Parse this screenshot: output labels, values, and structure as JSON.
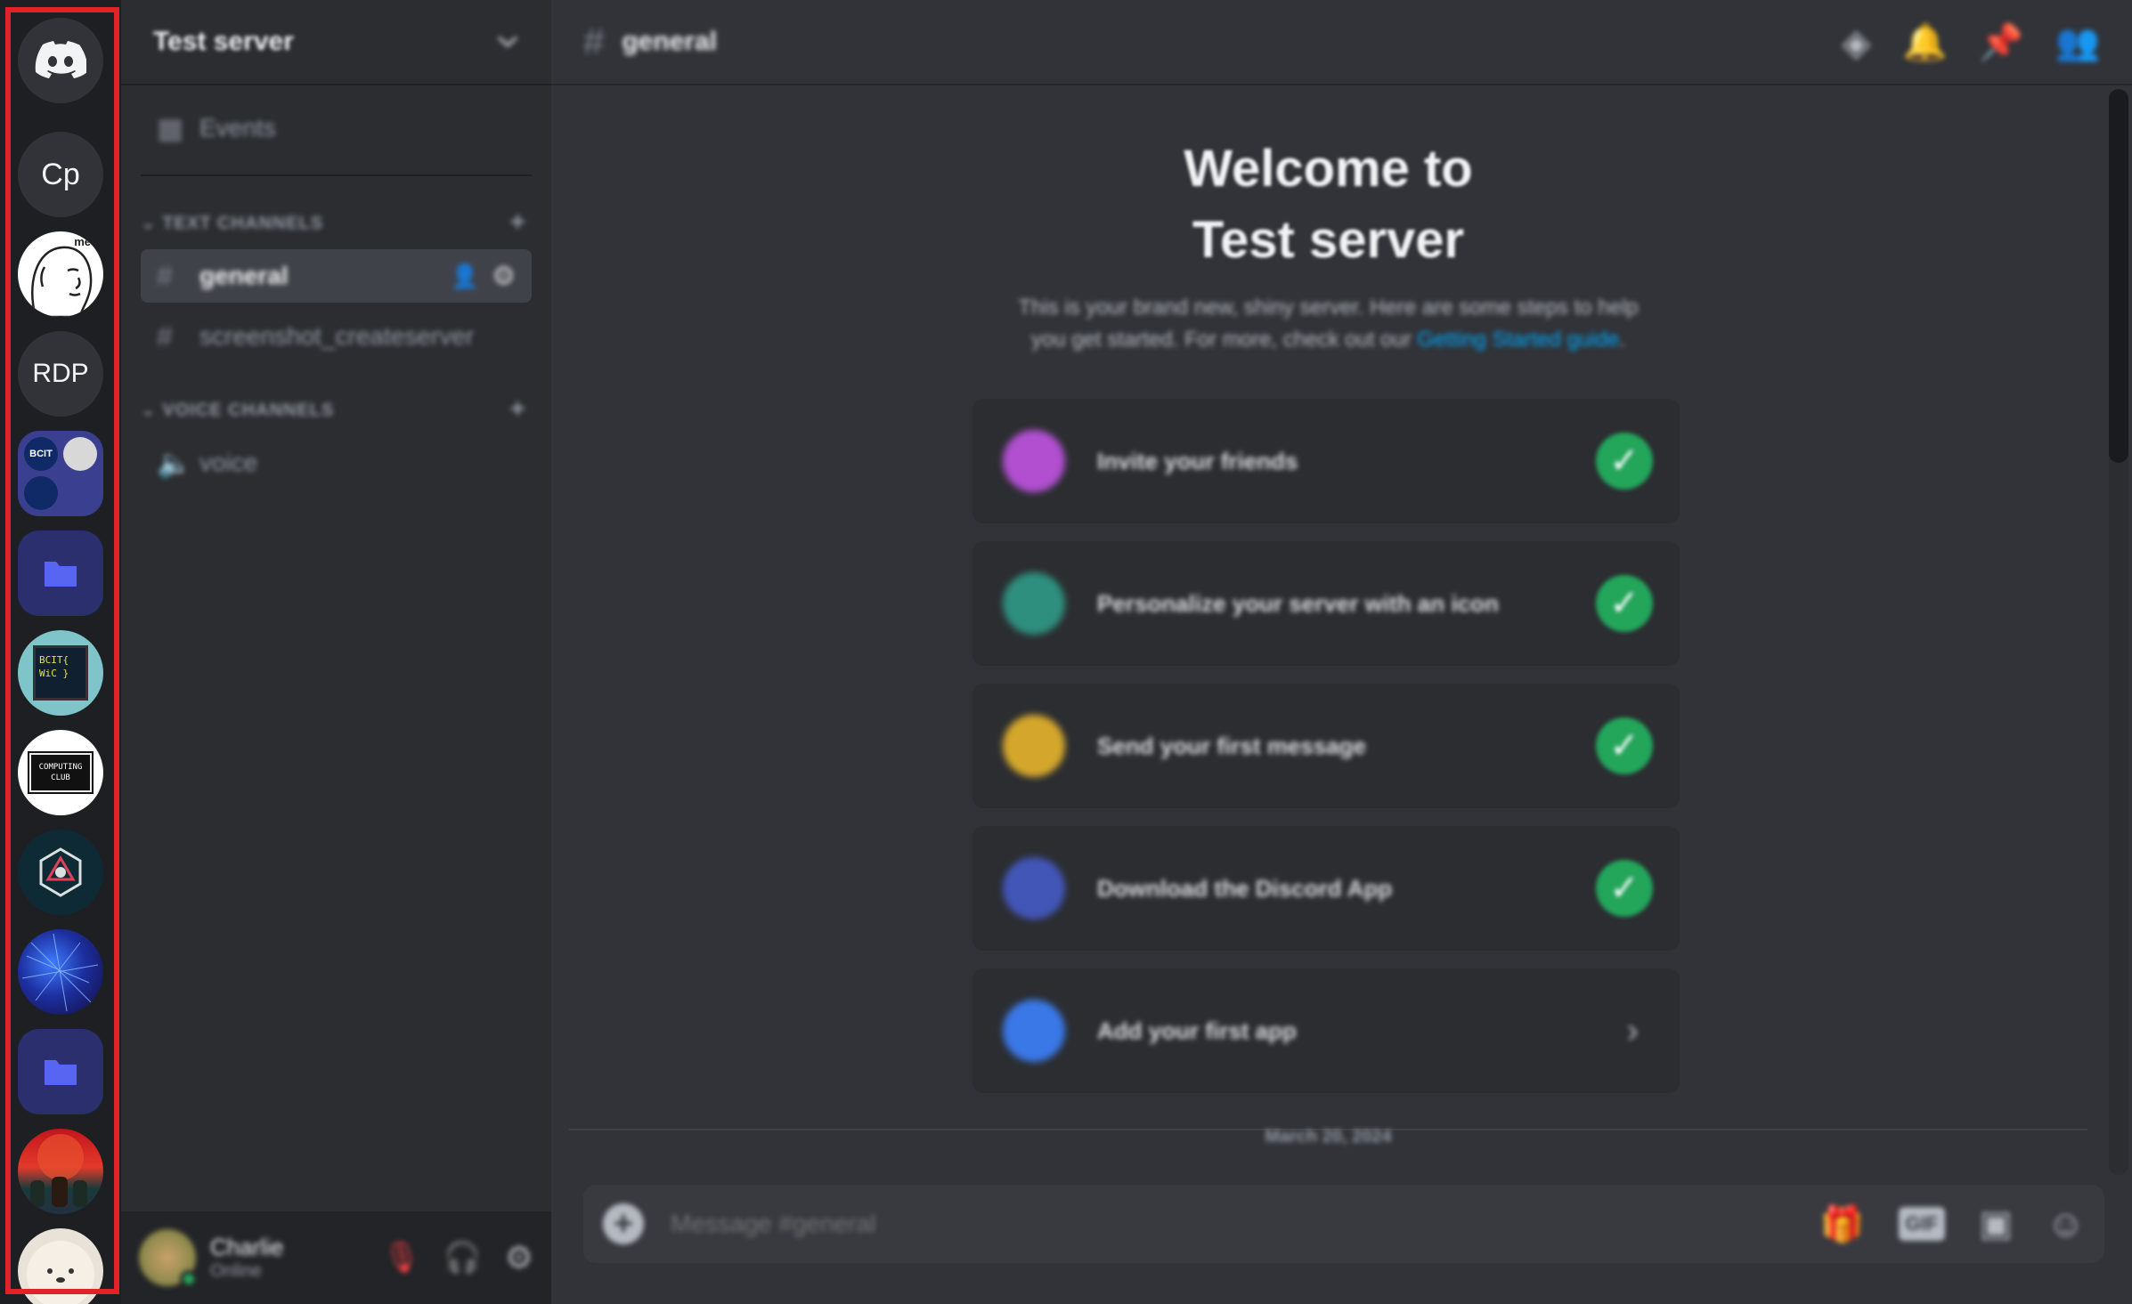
{
  "server_rail": {
    "items": [
      {
        "kind": "home",
        "icon": "discord-logo-icon"
      },
      {
        "kind": "text",
        "label": "Cp"
      },
      {
        "kind": "image",
        "icon": "meme-face-icon",
        "badge": "me"
      },
      {
        "kind": "text",
        "label": "RDP"
      },
      {
        "kind": "image",
        "icon": "bcit-group-icon",
        "label": "BCIT"
      },
      {
        "kind": "folder",
        "icon": "folder-icon"
      },
      {
        "kind": "image",
        "icon": "bcit-wic-icon",
        "label": "BCIT{ WiC }"
      },
      {
        "kind": "image",
        "icon": "computing-club-icon",
        "label": "COMPUTING CLUB"
      },
      {
        "kind": "image",
        "icon": "hexagon-logo-icon"
      },
      {
        "kind": "image",
        "icon": "network-art-icon"
      },
      {
        "kind": "folder",
        "icon": "folder-icon"
      },
      {
        "kind": "image",
        "icon": "red-moon-art-icon"
      },
      {
        "kind": "image",
        "icon": "fluffy-dog-icon"
      }
    ],
    "highlight_color": "#e0222b"
  },
  "sidebar": {
    "server_name": "Test server",
    "events_label": "Events",
    "text_category": "TEXT CHANNELS",
    "voice_category": "VOICE CHANNELS",
    "text_channels": [
      "general",
      "screenshot_createserver"
    ],
    "voice_channels": [
      "voice"
    ],
    "user": {
      "name": "Charlie",
      "status": "Online"
    }
  },
  "chat": {
    "channel_name": "general",
    "welcome_title_line1": "Welcome to",
    "welcome_title_line2": "Test server",
    "welcome_sub_line1": "This is your brand new, shiny server. Here are some steps to help",
    "welcome_sub_line2": "you get started. For more, check out our",
    "welcome_link": "Getting Started guide",
    "checklist": [
      {
        "label": "Invite your friends",
        "done": true
      },
      {
        "label": "Personalize your server with an icon",
        "done": true
      },
      {
        "label": "Send your first message",
        "done": true
      },
      {
        "label": "Download the Discord App",
        "done": true
      },
      {
        "label": "Add your first app",
        "done": false
      }
    ],
    "date_divider": "March 20, 2024",
    "composer_placeholder": "Message #general"
  },
  "colors": {
    "accent_green": "#23a55a",
    "link_blue": "#00a8fc",
    "blurple": "#5865f2"
  }
}
